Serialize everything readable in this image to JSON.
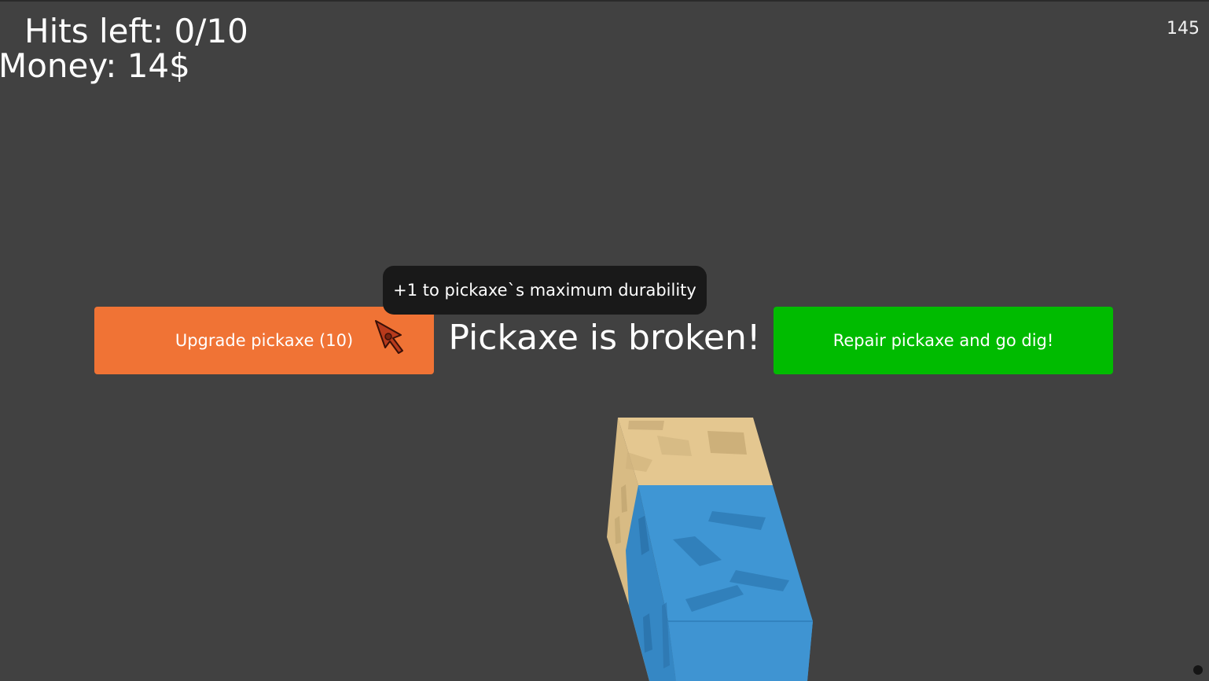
{
  "hud": {
    "hits_left_label": "Hits left: 0/10",
    "money_label": "Money: 14$",
    "fps": "145"
  },
  "main": {
    "status_text": "Pickaxe is broken!",
    "upgrade_button_label": "Upgrade pickaxe (10)",
    "repair_button_label": "Repair pickaxe and go dig!",
    "tooltip_text": "+1 to pickaxe`s maximum durability"
  },
  "colors": {
    "background": "#414141",
    "upgrade_button": "#f07335",
    "repair_button": "#00bb00",
    "tooltip_bg": "#191919",
    "block_sand": "#e4c790",
    "block_blue": "#3f96d4"
  },
  "icons": {
    "cursor": "pointer-arrow-icon",
    "block": "dirt-block-icon"
  }
}
